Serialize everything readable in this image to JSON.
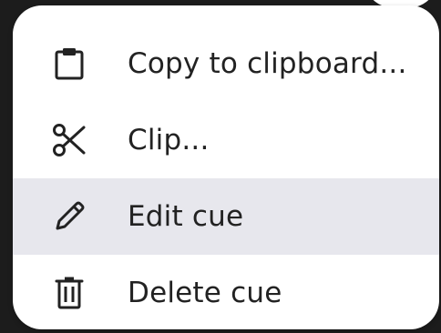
{
  "menu": {
    "items": [
      {
        "label": "Copy to clipboard...",
        "icon": "clipboard-icon",
        "highlighted": false
      },
      {
        "label": "Clip...",
        "icon": "scissors-icon",
        "highlighted": false
      },
      {
        "label": "Edit cue",
        "icon": "pencil-icon",
        "highlighted": true
      },
      {
        "label": "Delete cue",
        "icon": "trash-icon",
        "highlighted": false
      }
    ],
    "highlight_color": "#e7e7ed",
    "text_color": "#222222"
  }
}
